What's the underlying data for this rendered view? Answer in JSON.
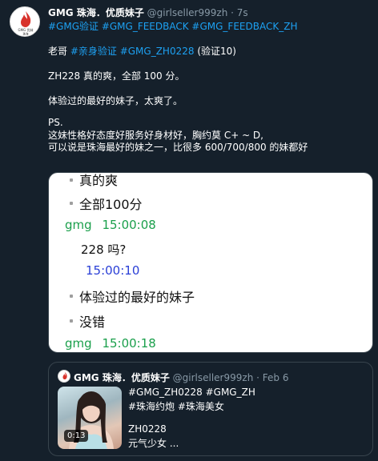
{
  "tweet": {
    "author_name": "GMG 珠海．优质妹子",
    "author_handle": "@girlseller999zh",
    "separator": " · ",
    "time": "7s",
    "avatar_label": "GMG 优妹",
    "avatar_sub": "珠海",
    "tags": "#GMG验证 #GMG_FEEDBACK #GMG_FEEDBACK_ZH",
    "line1_prefix": "老哥 ",
    "line1_tags": "#亲身验证 #GMG_ZH0228",
    "line1_suffix": " (验证10)",
    "line2": "ZH228 真的爽，全部 100 分。",
    "line3": "体验过的最好的妹子，太爽了。",
    "line4": "PS.",
    "line5": "这妹性格好态度好服务好身材好，胸约莫 C+ ~ D,",
    "line6": "可以说是珠海最好的妹之一，比很多 600/700/800 的妹都好"
  },
  "chat": {
    "msg1": "真的爽",
    "msg2": "全部100分",
    "sender1": "gmg",
    "time1": "15:00:08",
    "msg3": "228 吗?",
    "time2": "15:00:10",
    "msg4": "体验过的最好的妹子",
    "msg5": "没错",
    "sender2": "gmg",
    "time3": "15:00:18"
  },
  "quote": {
    "author_name": "GMG 珠海．优质妹子",
    "author_handle": "@girlseller999zh",
    "separator": " · ",
    "date": "Feb 6",
    "duration": "0:13",
    "line1": "#GMG_ZH0228 #GMG_ZH",
    "line2": "#珠海约炮 #珠海美女",
    "line3": "ZH0228",
    "line4": "元气少女 ..."
  },
  "colors": {
    "background": "#15202b",
    "link": "#1da1f2",
    "muted": "#8899a6",
    "chat_green": "#1a9f4b",
    "chat_blue": "#2a3fd6",
    "logo_red": "#d8322b"
  },
  "icons": {
    "avatar": "flame-logo-icon",
    "quote_avatar": "flame-logo-icon"
  }
}
